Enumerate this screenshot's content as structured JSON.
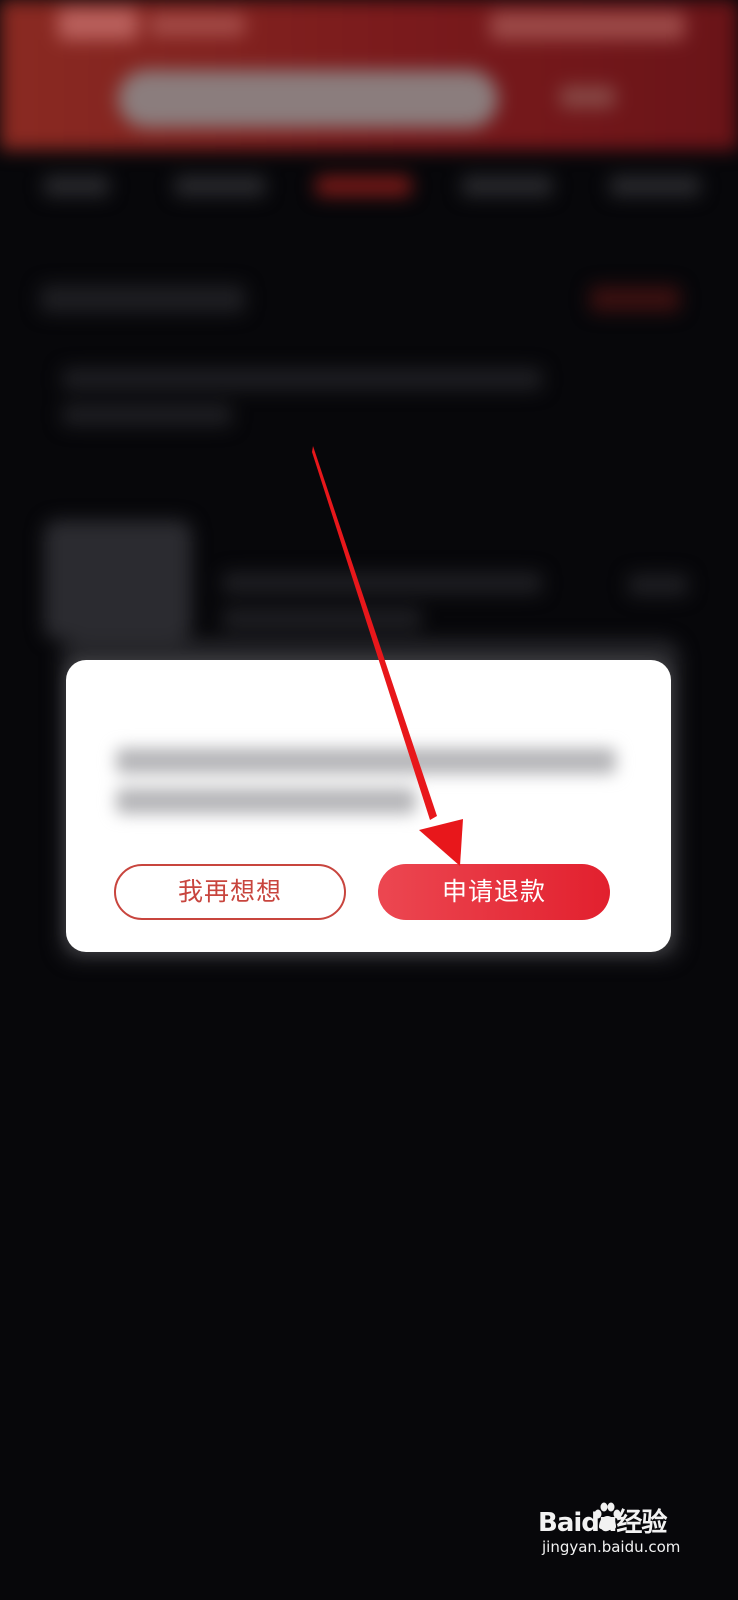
{
  "dialog": {
    "cancel_label": "我再想想",
    "confirm_label": "申请退款"
  },
  "annotation": {
    "arrow_color": "#e8171b",
    "target": "confirm-button"
  },
  "watermark": {
    "brand": "Baidu经验",
    "url": "jingyan.baidu.com"
  },
  "colors": {
    "accent_red": "#e2202e",
    "outline_red": "#c8453e",
    "backdrop": "#07070a"
  }
}
